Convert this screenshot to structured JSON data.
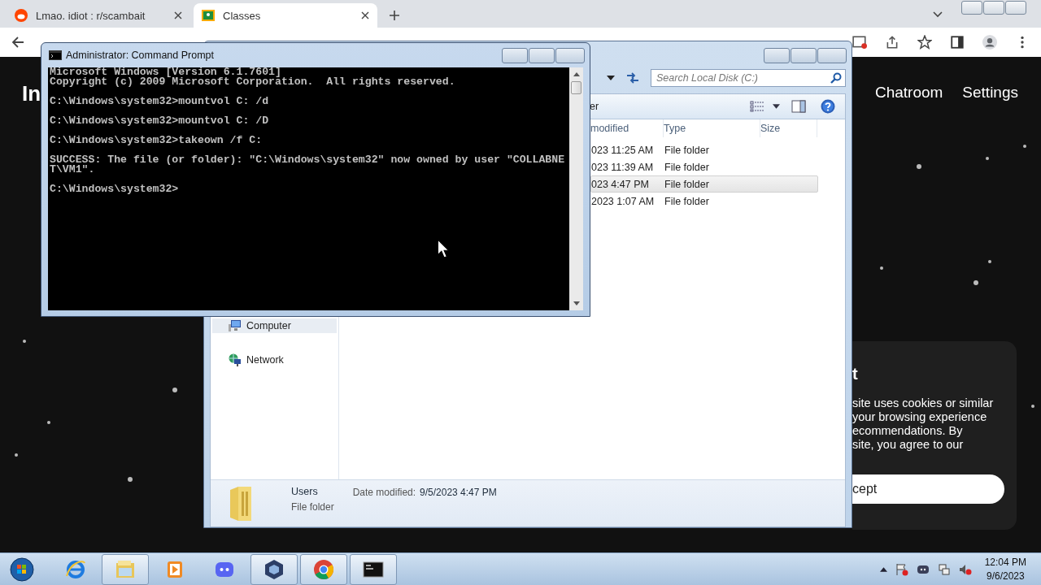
{
  "browser": {
    "tabs": [
      {
        "label": "Lmao. idiot : r/scambait",
        "selected": false
      },
      {
        "label": "Classes",
        "selected": true
      }
    ]
  },
  "page": {
    "logo": "In",
    "nav": [
      "Chatroom",
      "Settings"
    ],
    "cookie_notice": {
      "title": "t",
      "lines": [
        "site uses cookies or similar",
        "your browsing experience",
        "ecommendations. By",
        "site, you agree to our"
      ],
      "button": "cept"
    }
  },
  "explorer": {
    "search": {
      "placeholder": "Search Local Disk (C:)"
    },
    "toolbar_text": "er",
    "columns": [
      "modified",
      "Type",
      "Size"
    ],
    "rows": [
      {
        "date": "023 11:25 AM",
        "type": "File folder",
        "selected": false
      },
      {
        "date": "023 11:39 AM",
        "type": "File folder",
        "selected": false
      },
      {
        "date": "023 4:47 PM",
        "type": "File folder",
        "selected": true
      },
      {
        "date": "2023 1:07 AM",
        "type": "File folder",
        "selected": false
      }
    ],
    "nav_items": [
      {
        "label": "Computer",
        "selected": true
      },
      {
        "label": "Network",
        "selected": false
      }
    ],
    "details": {
      "name": "Users",
      "date_label": "Date modified:",
      "date": "9/5/2023 4:47 PM",
      "type": "File folder"
    }
  },
  "cmd": {
    "title": "Administrator:  Command Prompt",
    "blocks": [
      [
        "Microsoft Windows [Version 6.1.7601]",
        "Copyright (c) 2009 Microsoft Corporation.  All rights reserved."
      ],
      [
        "C:\\Windows\\system32>mountvol C: /d"
      ],
      [
        "C:\\Windows\\system32>mountvol C: /D"
      ],
      [
        "C:\\Windows\\system32>takeown /f C:"
      ],
      [
        "SUCCESS: The file (or folder): \"C:\\Windows\\system32\" now owned by user \"COLLABNE",
        "T\\VM1\"."
      ],
      [
        "C:\\Windows\\system32>"
      ]
    ]
  },
  "taskbar": {
    "buttons": [
      {
        "open": false
      },
      {
        "open": true
      },
      {
        "open": false
      },
      {
        "open": false
      },
      {
        "open": true
      },
      {
        "open": true
      },
      {
        "open": true
      }
    ],
    "time": "12:04 PM",
    "date": "9/6/2023"
  }
}
